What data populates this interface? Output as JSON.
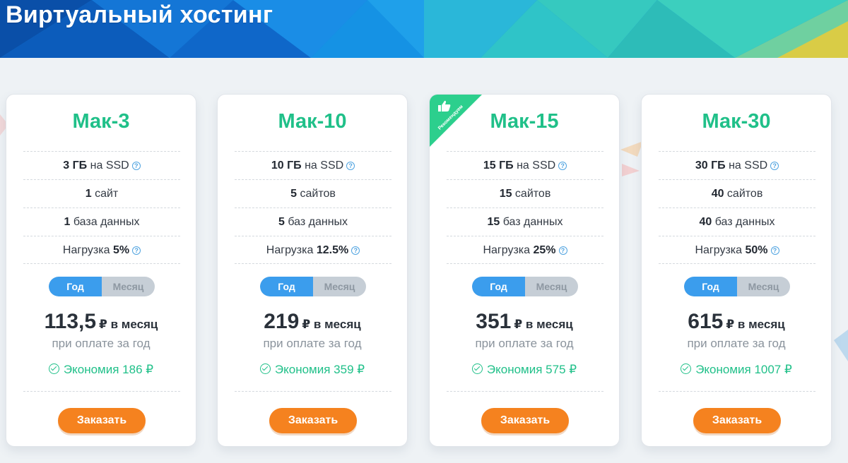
{
  "banner": {
    "title": "Виртуальный хостинг"
  },
  "plans": [
    {
      "name": "Мак-3",
      "recommended": false,
      "features": [
        {
          "strong": "3 ГБ",
          "text": " на SSD",
          "help": true
        },
        {
          "strong": "1",
          "text": " сайт",
          "help": false
        },
        {
          "strong": "1",
          "text": " база данных",
          "help": false
        },
        {
          "prefix": "Нагрузка ",
          "strong": "5%",
          "help": true
        }
      ],
      "toggle": {
        "year": "Год",
        "month": "Месяц",
        "active": "year"
      },
      "price": "113,5",
      "price_unit": "₽ в месяц",
      "price_note": "при оплате за год",
      "savings": "Экономия 186 ₽",
      "order_label": "Заказать"
    },
    {
      "name": "Мак-10",
      "recommended": false,
      "features": [
        {
          "strong": "10 ГБ",
          "text": " на SSD",
          "help": true
        },
        {
          "strong": "5",
          "text": " сайтов",
          "help": false
        },
        {
          "strong": "5",
          "text": " баз данных",
          "help": false
        },
        {
          "prefix": "Нагрузка ",
          "strong": "12.5%",
          "help": true
        }
      ],
      "toggle": {
        "year": "Год",
        "month": "Месяц",
        "active": "year"
      },
      "price": "219",
      "price_unit": "₽ в месяц",
      "price_note": "при оплате за год",
      "savings": "Экономия 359 ₽",
      "order_label": "Заказать"
    },
    {
      "name": "Мак-15",
      "recommended": true,
      "badge": "Рекомендуем",
      "features": [
        {
          "strong": "15 ГБ",
          "text": " на SSD",
          "help": true
        },
        {
          "strong": "15",
          "text": " сайтов",
          "help": false
        },
        {
          "strong": "15",
          "text": " баз данных",
          "help": false
        },
        {
          "prefix": "Нагрузка ",
          "strong": "25%",
          "help": true
        }
      ],
      "toggle": {
        "year": "Год",
        "month": "Месяц",
        "active": "year"
      },
      "price": "351",
      "price_unit": "₽ в месяц",
      "price_note": "при оплате за год",
      "savings": "Экономия 575 ₽",
      "order_label": "Заказать"
    },
    {
      "name": "Мак-30",
      "recommended": false,
      "features": [
        {
          "strong": "30 ГБ",
          "text": " на SSD",
          "help": true
        },
        {
          "strong": "40",
          "text": " сайтов",
          "help": false
        },
        {
          "strong": "40",
          "text": " баз данных",
          "help": false
        },
        {
          "prefix": "Нагрузка ",
          "strong": "50%",
          "help": true
        }
      ],
      "toggle": {
        "year": "Год",
        "month": "Месяц",
        "active": "year"
      },
      "price": "615",
      "price_unit": "₽ в месяц",
      "price_note": "при оплате за год",
      "savings": "Экономия 1007 ₽",
      "order_label": "Заказать"
    }
  ],
  "colors": {
    "accent_green": "#20c089",
    "toggle_active": "#3b9ded",
    "order_button": "#f5821f",
    "banner_blue": "#0a6fd0"
  }
}
